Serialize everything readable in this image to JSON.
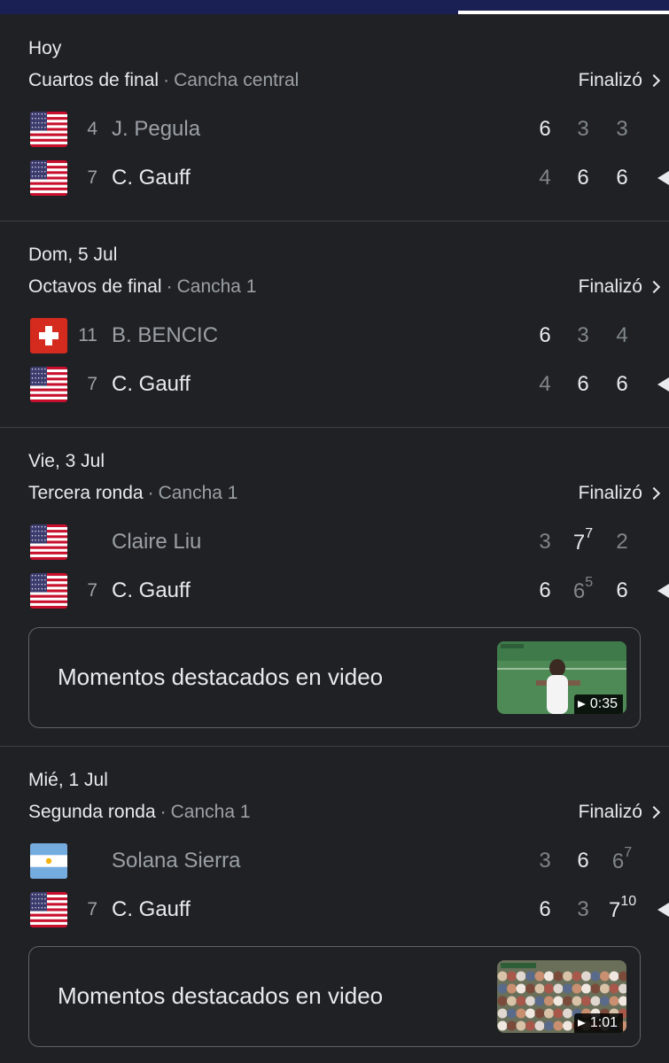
{
  "matches": [
    {
      "date": "Hoy",
      "round": "Cuartos de final",
      "separator": "·",
      "court": "Cancha central",
      "status": "Finalizó",
      "players": [
        {
          "flag": "usa-flag-icon",
          "seed": "4",
          "name": "J. Pegula",
          "winner": false,
          "sets": [
            {
              "v": "6",
              "w": true
            },
            {
              "v": "3",
              "w": false
            },
            {
              "v": "3",
              "w": false
            }
          ]
        },
        {
          "flag": "usa-flag-icon",
          "seed": "7",
          "name": "C. Gauff",
          "winner": true,
          "sets": [
            {
              "v": "4",
              "w": false
            },
            {
              "v": "6",
              "w": true
            },
            {
              "v": "6",
              "w": true
            }
          ]
        }
      ]
    },
    {
      "date": "Dom, 5 Jul",
      "round": "Octavos de final",
      "separator": "·",
      "court": "Cancha 1",
      "status": "Finalizó",
      "players": [
        {
          "flag": "switzerland-flag-icon",
          "seed": "11",
          "name": "B. BENCIC",
          "winner": false,
          "sets": [
            {
              "v": "6",
              "w": true
            },
            {
              "v": "3",
              "w": false
            },
            {
              "v": "4",
              "w": false
            }
          ]
        },
        {
          "flag": "usa-flag-icon",
          "seed": "7",
          "name": "C. Gauff",
          "winner": true,
          "sets": [
            {
              "v": "4",
              "w": false
            },
            {
              "v": "6",
              "w": true
            },
            {
              "v": "6",
              "w": true
            }
          ]
        }
      ]
    },
    {
      "date": "Vie, 3 Jul",
      "round": "Tercera ronda",
      "separator": "·",
      "court": "Cancha 1",
      "status": "Finalizó",
      "players": [
        {
          "flag": "usa-flag-icon",
          "seed": "",
          "name": "Claire Liu",
          "winner": false,
          "sets": [
            {
              "v": "3",
              "w": false
            },
            {
              "v": "7",
              "sup": "7",
              "w": true
            },
            {
              "v": "2",
              "w": false
            }
          ]
        },
        {
          "flag": "usa-flag-icon",
          "seed": "7",
          "name": "C. Gauff",
          "winner": true,
          "sets": [
            {
              "v": "6",
              "w": true
            },
            {
              "v": "6",
              "sup": "5",
              "w": false
            },
            {
              "v": "6",
              "w": true
            }
          ]
        }
      ],
      "video": {
        "label": "Momentos destacados en video",
        "duration": "0:35"
      }
    },
    {
      "date": "Mié, 1 Jul",
      "round": "Segunda ronda",
      "separator": "·",
      "court": "Cancha 1",
      "status": "Finalizó",
      "players": [
        {
          "flag": "argentina-flag-icon",
          "seed": "",
          "name": "Solana Sierra",
          "winner": false,
          "sets": [
            {
              "v": "3",
              "w": false
            },
            {
              "v": "6",
              "w": true
            },
            {
              "v": "6",
              "sup": "7",
              "w": false
            }
          ]
        },
        {
          "flag": "usa-flag-icon",
          "seed": "7",
          "name": "C. Gauff",
          "winner": true,
          "sets": [
            {
              "v": "6",
              "w": true
            },
            {
              "v": "3",
              "w": false
            },
            {
              "v": "7",
              "sup": "10",
              "w": true
            }
          ]
        }
      ],
      "video": {
        "label": "Momentos destacados en video",
        "duration": "1:01"
      }
    }
  ]
}
